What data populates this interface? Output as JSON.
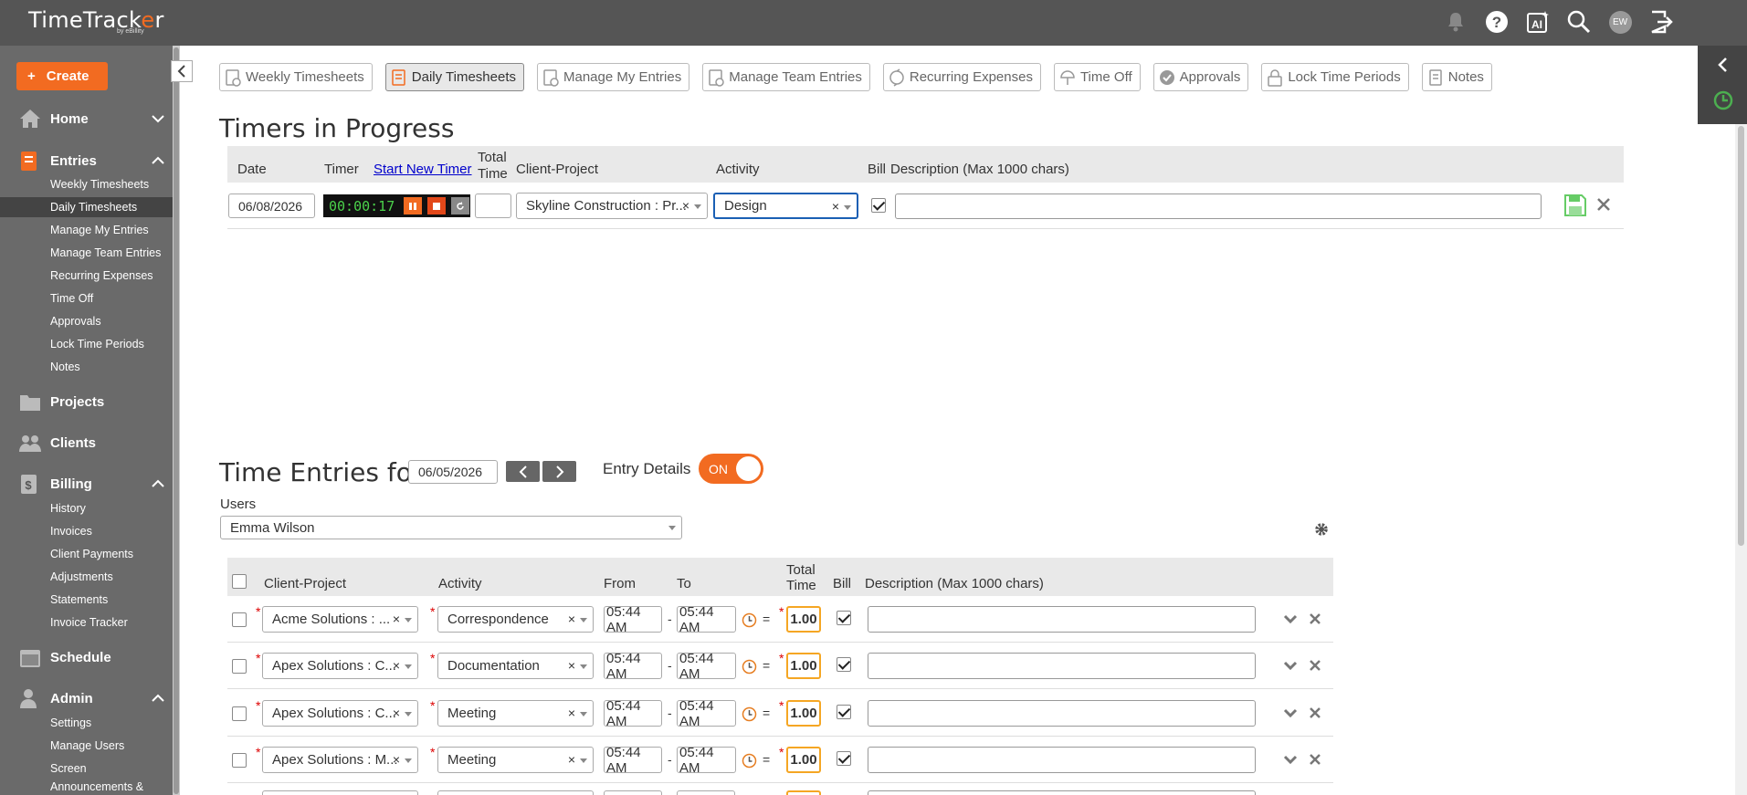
{
  "app": {
    "logo_main": "TimeTrack",
    "logo_o": "e",
    "logo_end": "r",
    "logo_sub": "by eBillity",
    "avatar": "EW"
  },
  "topbar_icons": [
    "bell-icon",
    "help-icon",
    "ai-icon",
    "search-icon",
    "avatar",
    "logout-icon"
  ],
  "sidebar": {
    "create_label": "Create",
    "home": "Home",
    "entries": "Entries",
    "entries_items": [
      "Weekly Timesheets",
      "Daily Timesheets",
      "Manage My Entries",
      "Manage Team Entries",
      "Recurring Expenses",
      "Time Off",
      "Approvals",
      "Lock Time Periods",
      "Notes"
    ],
    "projects": "Projects",
    "clients": "Clients",
    "billing": "Billing",
    "billing_items": [
      "History",
      "Invoices",
      "Client Payments",
      "Adjustments",
      "Statements",
      "Invoice Tracker"
    ],
    "schedule": "Schedule",
    "admin": "Admin",
    "admin_items": [
      "Settings",
      "Manage Users",
      "Screen",
      "Announcements &"
    ]
  },
  "tabs": [
    "Weekly Timesheets",
    "Daily Timesheets",
    "Manage My Entries",
    "Manage Team Entries",
    "Recurring Expenses",
    "Time Off",
    "Approvals",
    "Lock Time Periods",
    "Notes"
  ],
  "active_tab": "Daily Timesheets",
  "timers": {
    "title": "Timers in Progress",
    "headers": {
      "date": "Date",
      "timer": "Timer",
      "start_new": "Start New Timer",
      "total1": "Total",
      "total2": "Time",
      "client_project": "Client-Project",
      "activity": "Activity",
      "bill": "Bill",
      "description": "Description (Max 1000 chars)"
    },
    "row": {
      "date": "06/08/2026",
      "time": "00:00:17",
      "total": "",
      "client_project": "Skyline Construction : Pr...",
      "activity": "Design",
      "bill": true,
      "description": ""
    }
  },
  "entries": {
    "title": "Time Entries for",
    "date": "06/05/2026",
    "entry_details_label": "Entry Details",
    "toggle_label": "ON",
    "users_label": "Users",
    "user": "Emma Wilson",
    "headers": {
      "client_project": "Client-Project",
      "activity": "Activity",
      "from": "From",
      "to": "To",
      "total1": "Total",
      "total2": "Time",
      "bill": "Bill",
      "description": "Description (Max 1000 chars)"
    },
    "rows": [
      {
        "client_project": "Acme Solutions : ...",
        "activity": "Correspondence",
        "from": "05:44 AM",
        "to": "05:44 AM",
        "total": "1.00",
        "bill": true,
        "description": ""
      },
      {
        "client_project": "Apex Solutions : C...",
        "activity": "Documentation",
        "from": "05:44 AM",
        "to": "05:44 AM",
        "total": "1.00",
        "bill": true,
        "description": ""
      },
      {
        "client_project": "Apex Solutions : C...",
        "activity": "Meeting",
        "from": "05:44 AM",
        "to": "05:44 AM",
        "total": "1.00",
        "bill": true,
        "description": ""
      },
      {
        "client_project": "Apex Solutions : M...",
        "activity": "Meeting",
        "from": "05:44 AM",
        "to": "05:44 AM",
        "total": "1.00",
        "bill": true,
        "description": ""
      }
    ],
    "dash": "-",
    "equals": "=",
    "req": "*"
  },
  "colors": {
    "accent": "#f26b21",
    "sidebar": "#6a6a6a",
    "topbar": "#555555",
    "timer_green": "#4bd24b"
  }
}
